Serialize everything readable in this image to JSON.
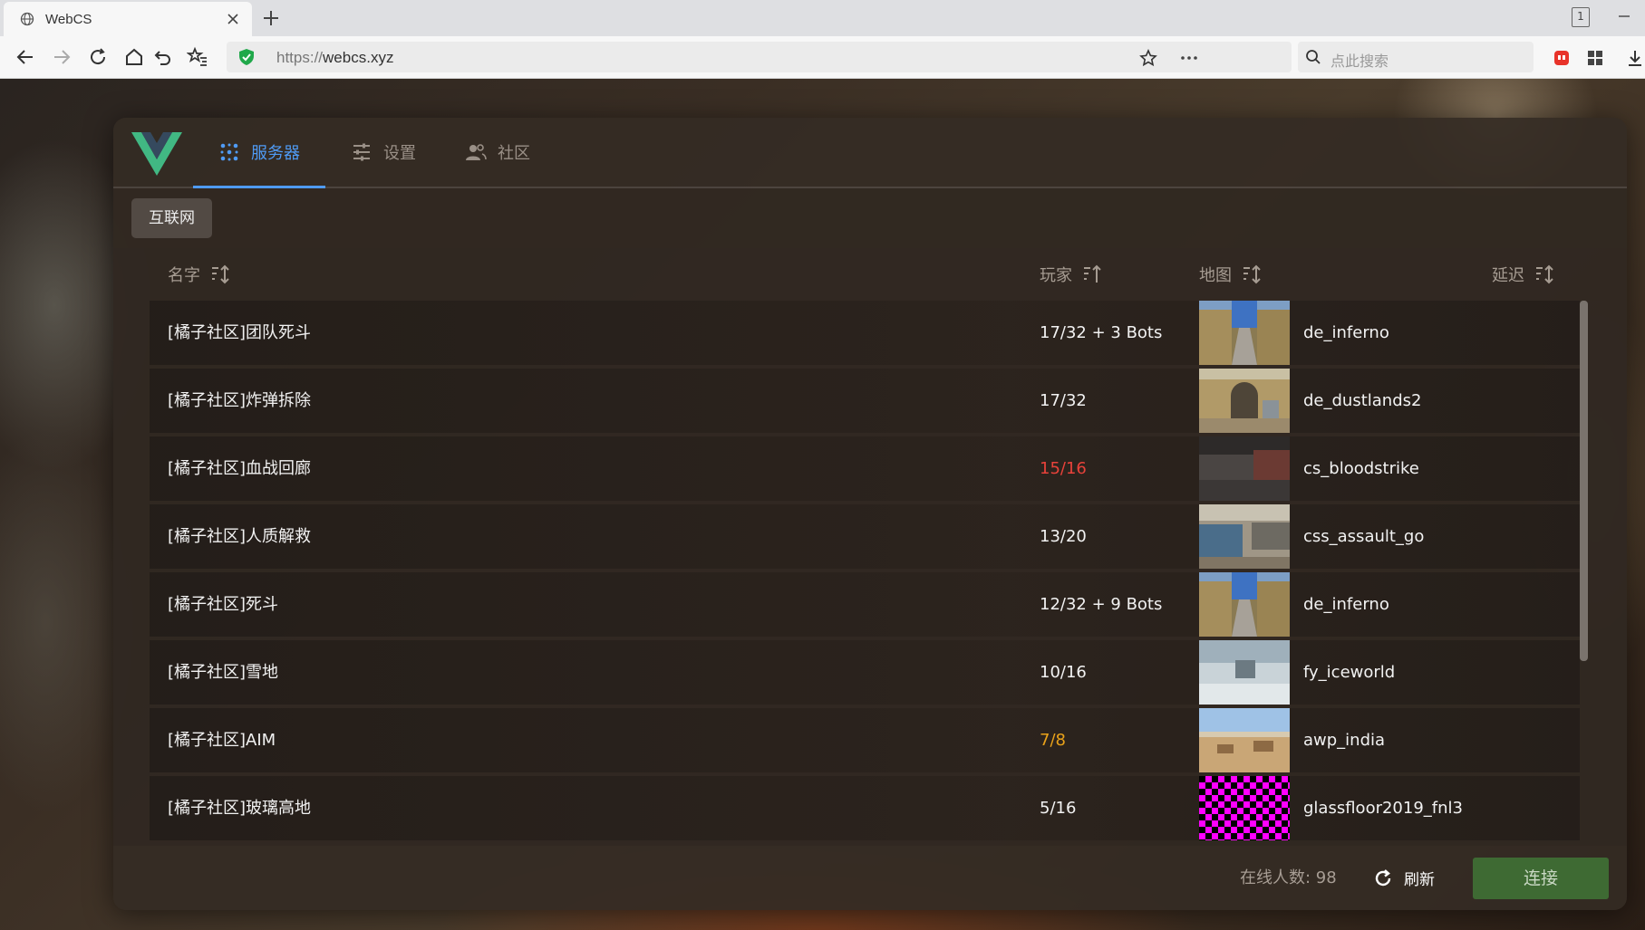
{
  "browser": {
    "tab_title": "WebCS",
    "url_protocol": "https://",
    "url_host": "webcs.xyz",
    "search_placeholder": "点此搜索",
    "window_badge": "1"
  },
  "app": {
    "nav": [
      {
        "label": "服务器",
        "icon": "servers-icon",
        "active": true
      },
      {
        "label": "设置",
        "icon": "sliders-icon",
        "active": false
      },
      {
        "label": "社区",
        "icon": "people-icon",
        "active": false
      }
    ],
    "filter_chip": "互联网",
    "columns": {
      "name": "名字",
      "players": "玩家",
      "map": "地图",
      "ping": "延迟"
    },
    "servers": [
      {
        "name": "[橘子社区]团队死斗",
        "players": "17/32 + 3 Bots",
        "player_color": "#f2f2f2",
        "map": "de_inferno"
      },
      {
        "name": "[橘子社区]炸弹拆除",
        "players": "17/32",
        "player_color": "#f2f2f2",
        "map": "de_dustlands2"
      },
      {
        "name": "[橘子社区]血战回廊",
        "players": "15/16",
        "player_color": "#e8423a",
        "map": "cs_bloodstrike"
      },
      {
        "name": "[橘子社区]人质解救",
        "players": "13/20",
        "player_color": "#f2f2f2",
        "map": "css_assault_go"
      },
      {
        "name": "[橘子社区]死斗",
        "players": "12/32 + 9 Bots",
        "player_color": "#f2f2f2",
        "map": "de_inferno"
      },
      {
        "name": "[橘子社区]雪地",
        "players": "10/16",
        "player_color": "#f2f2f2",
        "map": "fy_iceworld"
      },
      {
        "name": "[橘子社区]AIM",
        "players": "7/8",
        "player_color": "#e9a21a",
        "map": "awp_india"
      },
      {
        "name": "[橘子社区]玻璃高地",
        "players": "5/16",
        "player_color": "#f2f2f2",
        "map": "glassfloor2019_fnl3"
      }
    ],
    "footer": {
      "online_label": "在线人数: 98",
      "refresh_label": "刷新",
      "connect_label": "连接"
    }
  },
  "colors": {
    "accent": "#4f9bf5",
    "connect": "#3e6a33",
    "full": "#e8423a",
    "near_full": "#e9a21a"
  }
}
